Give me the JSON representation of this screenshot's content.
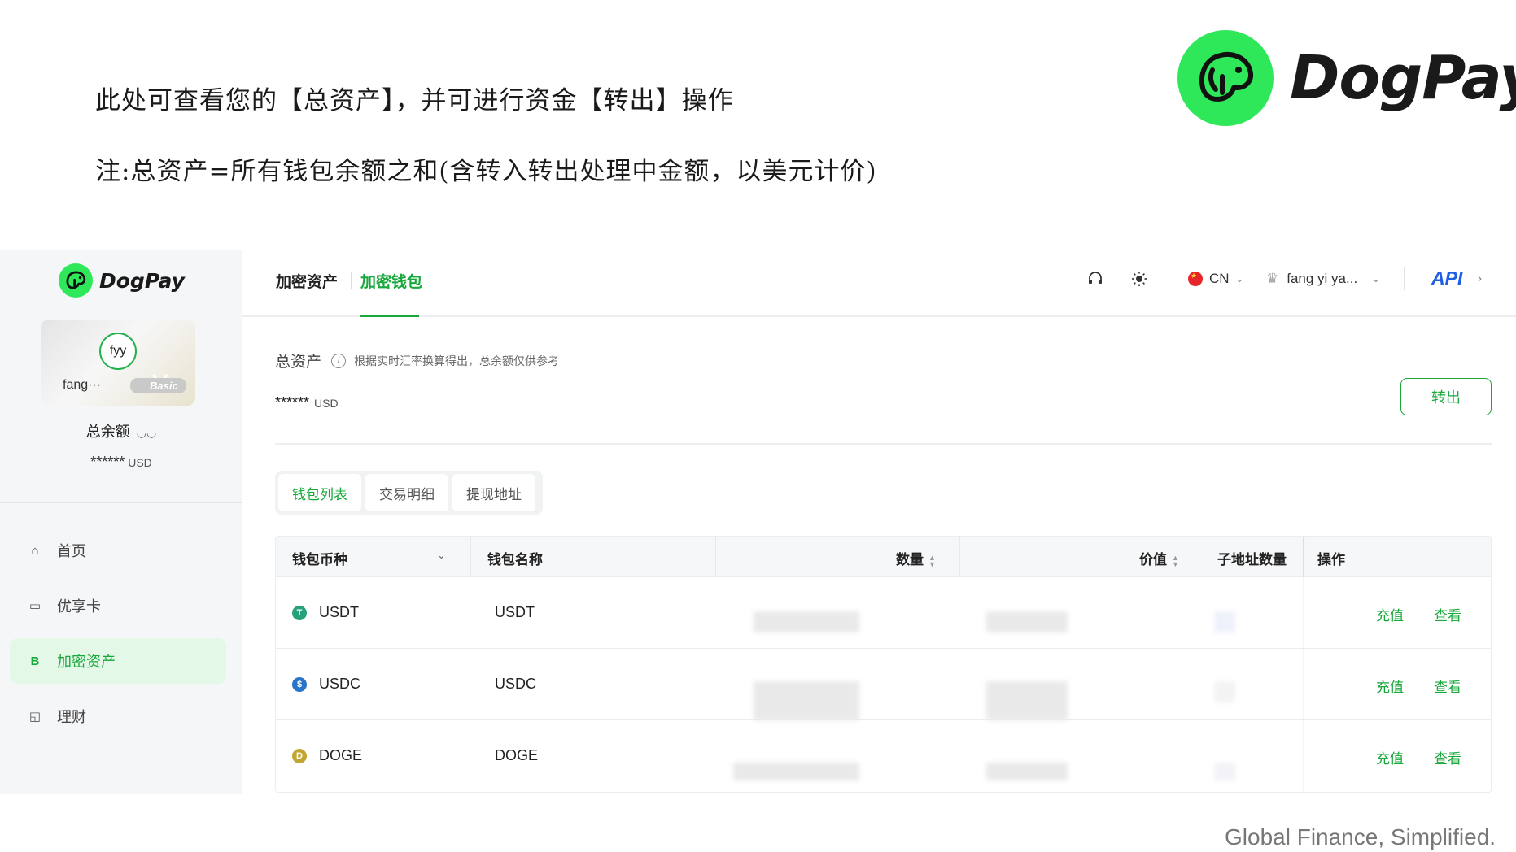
{
  "intro": {
    "line1": "此处可查看您的【总资产】，并可进行资金【转出】操作",
    "line2": "注:总资产=所有钱包余额之和(含转入转出处理中金额，以美元计价)",
    "brand": "DogPay"
  },
  "sidebar": {
    "brand": "DogPay",
    "card": {
      "avatar_text": "fyy",
      "username": "fang···",
      "tier": "Basic",
      "tier_mark": "V"
    },
    "balance_label": "总余额",
    "balance_value": "******",
    "balance_unit": "USD",
    "nav": [
      {
        "label": "首页",
        "icon": "home-icon"
      },
      {
        "label": "优享卡",
        "icon": "card-icon"
      },
      {
        "label": "加密资产",
        "icon": "bitcoin-icon",
        "active": true
      },
      {
        "label": "理财",
        "icon": "chart-icon"
      }
    ]
  },
  "topbar": {
    "crumb": "加密资产",
    "tab": "加密钱包",
    "lang": "CN",
    "user": "fang yi ya...",
    "api": "API"
  },
  "assets": {
    "label": "总资产",
    "hint": "根据实时汇率换算得出，总余额仅供参考",
    "value": "******",
    "unit": "USD",
    "transfer": "转出"
  },
  "tabs": [
    "钱包列表",
    "交易明细",
    "提现地址"
  ],
  "table": {
    "columns": [
      "钱包币种",
      "钱包名称",
      "数量",
      "价值",
      "子地址数量",
      "操作"
    ],
    "rows": [
      {
        "coin": "USDT",
        "name": "USDT",
        "color": "#26a17b",
        "glyph": "T"
      },
      {
        "coin": "USDC",
        "name": "USDC",
        "color": "#2775ca",
        "glyph": "$"
      },
      {
        "coin": "DOGE",
        "name": "DOGE",
        "color": "#c2a633",
        "glyph": "D"
      }
    ],
    "action_deposit": "充值",
    "action_view": "查看"
  },
  "tagline": "Global Finance, Simplified."
}
